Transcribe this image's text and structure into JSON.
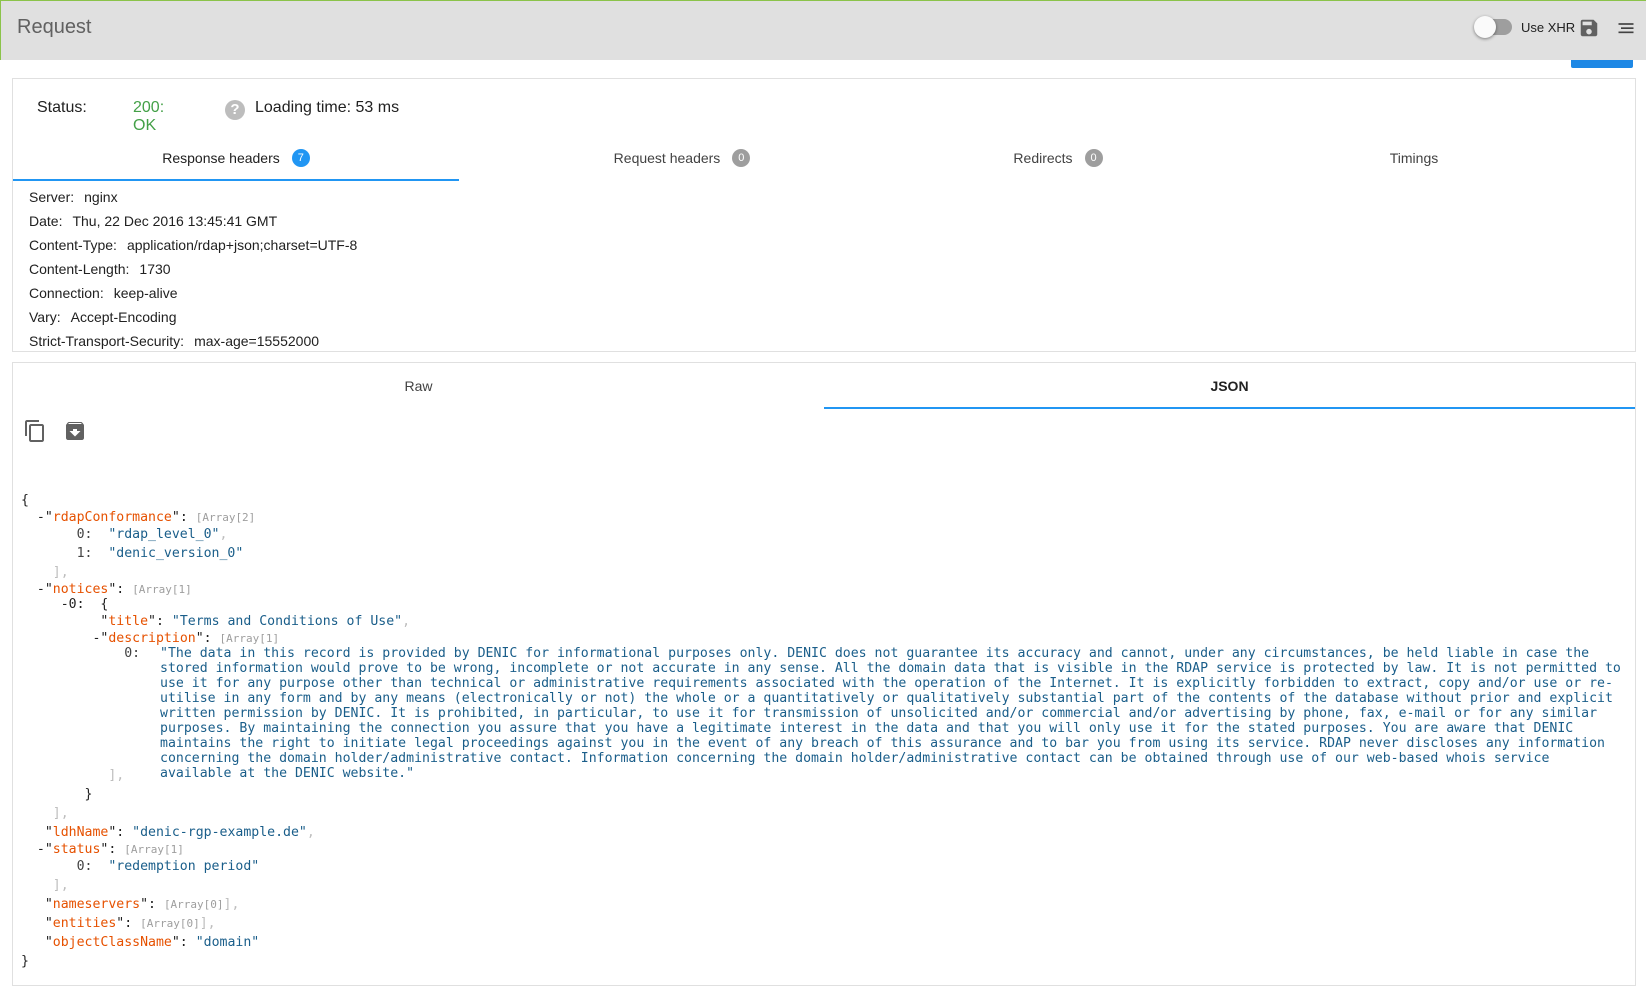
{
  "topbar": {
    "title": "Request",
    "xhr_label": "Use XHR",
    "xhr_enabled": false
  },
  "status": {
    "label": "Status:",
    "code": "200: OK",
    "help_symbol": "?",
    "loading_time": "Loading time: 53 ms"
  },
  "tabs": [
    {
      "label": "Response headers",
      "badge": "7",
      "active": true
    },
    {
      "label": "Request headers",
      "badge": "0",
      "active": false
    },
    {
      "label": "Redirects",
      "badge": "0",
      "active": false
    },
    {
      "label": "Timings",
      "badge": "",
      "active": false
    }
  ],
  "headers": [
    {
      "name": "Server:",
      "value": "nginx"
    },
    {
      "name": "Date:",
      "value": "Thu, 22 Dec 2016 13:45:41 GMT"
    },
    {
      "name": "Content-Type:",
      "value": "application/rdap+json;charset=UTF-8"
    },
    {
      "name": "Content-Length:",
      "value": "1730"
    },
    {
      "name": "Connection:",
      "value": "keep-alive"
    },
    {
      "name": "Vary:",
      "value": "Accept-Encoding"
    },
    {
      "name": "Strict-Transport-Security:",
      "value": "max-age=15552000"
    }
  ],
  "body_tabs": [
    {
      "label": "Raw",
      "active": false
    },
    {
      "label": "JSON",
      "active": true
    }
  ],
  "json_view": {
    "open_brace": "{",
    "close_brace": "}",
    "rdapConformance_key": "rdapConformance",
    "rdapConformance_meta": "[Array[2]",
    "rdap_0": "\"rdap_level_0\"",
    "rdap_1": "\"denic_version_0\"",
    "notices_key": "notices",
    "notices_meta": "[Array[1]",
    "title_key": "title",
    "title_value": "\"Terms and Conditions of Use\"",
    "description_key": "description",
    "description_meta": "[Array[1]",
    "description_value": "\"The data in this record is provided by DENIC for informational purposes only. DENIC does not guarantee its accuracy and cannot, under any circumstances, be held liable in case the stored information would prove to be wrong, incomplete or not accurate in any sense. All the domain data that is visible in the RDAP service is protected by law. It is not permitted to use it for any purpose other than technical or administrative requirements associated with the operation of the Internet. It is explicitly forbidden to extract, copy and/or use or re-utilise in any form and by any means (electronically or not) the whole or a quantitatively or qualitatively substantial part of the contents of the database without prior and explicit written permission by DENIC. It is prohibited, in particular, to use it for transmission of unsolicited and/or commercial and/or advertising by phone, fax, e-mail or for any similar purposes. By maintaining the connection you assure that you have a legitimate interest in the data and that you will only use it for the stated purposes. You are aware that DENIC maintains the right to initiate legal proceedings against you in the event of any breach of this assurance and to bar you from using its service. RDAP never discloses any information concerning the domain holder/administrative contact. Information concerning the domain holder/administrative contact can be obtained through use of our web-based whois service available at the DENIC website.\"",
    "ldhName_key": "ldhName",
    "ldhName_value": "\"denic-rgp-example.de\"",
    "status_key": "status",
    "status_meta": "[Array[1]",
    "status_0": "\"redemption period\"",
    "nameservers_key": "nameservers",
    "nameservers_meta": "[Array[0]",
    "entities_key": "entities",
    "entities_meta": "[Array[0]",
    "objectClassName_key": "objectClassName",
    "objectClassName_value": "\"domain\""
  }
}
